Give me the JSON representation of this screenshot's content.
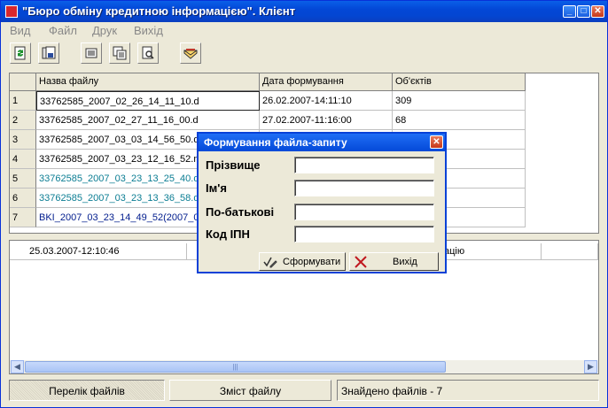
{
  "window": {
    "title": "\"Бюро обміну кредитною інформацією\". Клієнт",
    "minimize": "_",
    "maximize": "□",
    "close": "✕"
  },
  "menu": [
    "Вид",
    "Файл",
    "Друк",
    "Вихід"
  ],
  "toolbar_icons": [
    "refresh-icon",
    "save-icon",
    "list-icon",
    "copy-icon",
    "print-preview-icon",
    "envelope-icon"
  ],
  "table": {
    "headers": [
      "Назва файлу",
      "Дата формування",
      "Об'єктів"
    ],
    "rows": [
      {
        "n": "1",
        "file": "33762585_2007_02_26_14_11_10.d",
        "date": "26.02.2007-14:11:10",
        "count": "309"
      },
      {
        "n": "2",
        "file": "33762585_2007_02_27_11_16_00.d",
        "date": "27.02.2007-11:16:00",
        "count": "68"
      },
      {
        "n": "3",
        "file": "33762585_2007_03_03_14_56_50.d",
        "date": "",
        "count": ""
      },
      {
        "n": "4",
        "file": "33762585_2007_03_23_12_16_52.m",
        "date": "",
        "count": ""
      },
      {
        "n": "5",
        "file": "33762585_2007_03_23_13_25_40.d",
        "date": "",
        "count": ""
      },
      {
        "n": "6",
        "file": "33762585_2007_03_23_13_36_58.d",
        "date": "",
        "count": ""
      },
      {
        "n": "7",
        "file": "BKI_2007_03_23_14_49_52(2007_0",
        "date": "",
        "count": ""
      }
    ]
  },
  "detail": {
    "date": "25.03.2007-12:10:46",
    "right_text": "ацію"
  },
  "scroll": {
    "left": "◀",
    "right": "▶",
    "grip": "|||"
  },
  "status": {
    "tab1": "Перелік файлів",
    "tab2": "Зміст файлу",
    "found": "Знайдено файлів  -  7"
  },
  "dialog": {
    "title": "Формування файла-запиту",
    "close": "✕",
    "fields": [
      {
        "label": "Прізвище",
        "value": ""
      },
      {
        "label": "Ім'я",
        "value": ""
      },
      {
        "label": "По-батькові",
        "value": ""
      },
      {
        "label": "Код ІПН",
        "value": ""
      }
    ],
    "btn_form": "Сформувати",
    "btn_exit": "Вихід"
  },
  "colors": {
    "title_blue": "#0347d6",
    "teal_text": "#0b7d93",
    "navy_text": "#001c8d"
  }
}
